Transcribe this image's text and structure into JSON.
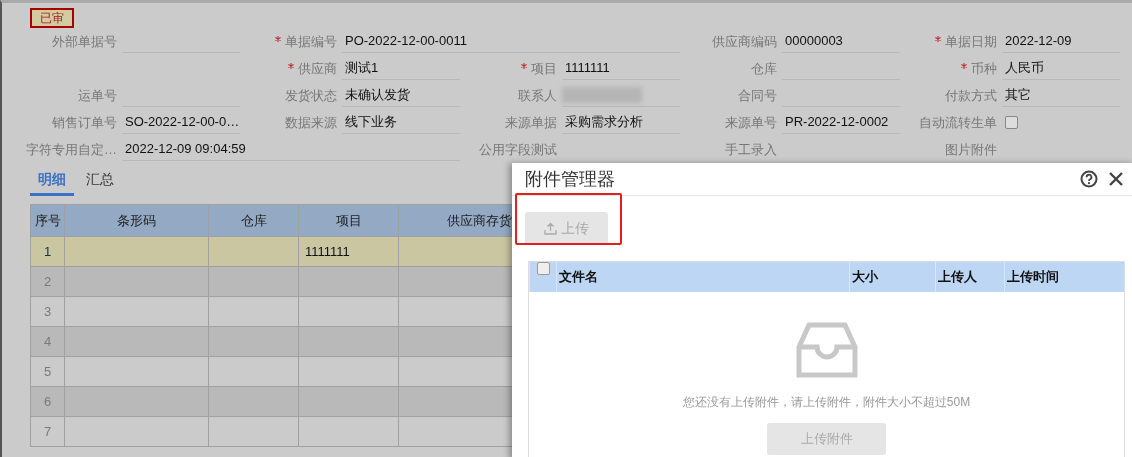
{
  "status_badge": "已审",
  "form": {
    "rows": [
      [
        {
          "kind": "text",
          "label": "外部单据号",
          "required": false
        },
        {
          "kind": "long_text",
          "label": "单据编号",
          "value": "PO-2022-12-00-0011",
          "required": true
        },
        {
          "kind": "text",
          "label": "供应商编码",
          "value": "00000003",
          "required": false
        },
        {
          "kind": "text",
          "label": "单据日期",
          "value": "2022-12-09",
          "required": true
        }
      ],
      [
        {
          "kind": "empty"
        },
        {
          "kind": "text",
          "label": "供应商",
          "value": "测试1",
          "required": true
        },
        {
          "kind": "text",
          "label": "项目",
          "value": "1111111",
          "required": true
        },
        {
          "kind": "text",
          "label": "仓库",
          "required": false
        },
        {
          "kind": "text",
          "label": "币种",
          "value": "人民币",
          "required": true
        }
      ],
      [
        {
          "kind": "text",
          "label": "运单号",
          "required": false
        },
        {
          "kind": "text",
          "label": "发货状态",
          "value": "未确认发货",
          "required": false
        },
        {
          "kind": "redacted",
          "label": "联系人",
          "required": false
        },
        {
          "kind": "text",
          "label": "合同号",
          "required": false
        },
        {
          "kind": "text",
          "label": "付款方式",
          "value": "其它",
          "required": false
        }
      ],
      [
        {
          "kind": "text",
          "label": "销售订单号",
          "value": "SO-2022-12-00-0…",
          "required": false
        },
        {
          "kind": "text",
          "label": "数据来源",
          "value": "线下业务",
          "required": false
        },
        {
          "kind": "text",
          "label": "来源单据",
          "value": "采购需求分析",
          "required": false
        },
        {
          "kind": "text",
          "label": "来源单号",
          "value": "PR-2022-12-0002",
          "required": false
        },
        {
          "kind": "checkbox",
          "label": "自动流转生单",
          "checked": false
        }
      ],
      [
        {
          "kind": "long_text",
          "label": "字符专用自定…",
          "value": "2022-12-09 09:04:59",
          "required": false
        },
        {
          "kind": "label",
          "label": "公用字段测试"
        },
        {
          "kind": "label",
          "label": "手工录入"
        },
        {
          "kind": "label",
          "label": "图片附件"
        }
      ]
    ]
  },
  "tabs": [
    {
      "label": "明细",
      "selected": true
    },
    {
      "label": "汇总",
      "selected": false
    }
  ],
  "table": {
    "columns": [
      "序号",
      "条形码",
      "仓库",
      "项目",
      "供应商存货"
    ],
    "rows": [
      {
        "selected": true,
        "cells": [
          "1",
          "",
          "",
          "1111111",
          ""
        ]
      },
      {
        "selected": false,
        "cells": [
          "2",
          "",
          "",
          "",
          ""
        ]
      },
      {
        "selected": false,
        "cells": [
          "3",
          "",
          "",
          "",
          ""
        ]
      },
      {
        "selected": false,
        "cells": [
          "4",
          "",
          "",
          "",
          ""
        ]
      },
      {
        "selected": false,
        "cells": [
          "5",
          "",
          "",
          "",
          ""
        ]
      },
      {
        "selected": false,
        "cells": [
          "6",
          "",
          "",
          "",
          ""
        ]
      },
      {
        "selected": false,
        "cells": [
          "7",
          "",
          "",
          "",
          ""
        ]
      }
    ]
  },
  "dialog": {
    "title": "附件管理器",
    "upload_button": {
      "label": "上传",
      "disabled": true
    },
    "file_table": {
      "columns": [
        "文件名",
        "大小",
        "上传人",
        "上传时间"
      ],
      "all_checked": false
    },
    "empty_message": "您还没有上传附件，请上传附件，附件大小不超过50M",
    "upload_attachment_button": "上传附件"
  }
}
